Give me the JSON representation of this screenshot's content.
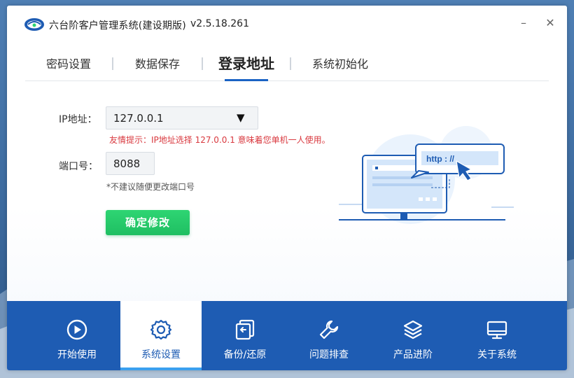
{
  "window": {
    "title": "六台阶客户管理系统(建设期版)",
    "version": "v2.5.18.261",
    "minimize_glyph": "–",
    "close_glyph": "✕"
  },
  "tabs": [
    {
      "label": "密码设置",
      "active": false
    },
    {
      "label": "数据保存",
      "active": false
    },
    {
      "label": "登录地址",
      "active": true
    },
    {
      "label": "系统初始化",
      "active": false
    }
  ],
  "form": {
    "ip_label": "IP地址：",
    "ip_value": "127.0.0.1",
    "ip_dropdown_glyph": "▼",
    "hint": "友情提示：IP地址选择 127.0.0.1 意味着您单机一人使用。",
    "port_label": "端口号：",
    "port_value": "8088",
    "port_note": "*不建议随便更改端口号",
    "confirm_label": "确定修改"
  },
  "illustration": {
    "url_text": "http : //"
  },
  "bottom_nav": [
    {
      "label": "开始使用",
      "icon": "play-circle-icon",
      "active": false
    },
    {
      "label": "系统设置",
      "icon": "gear-icon",
      "active": true
    },
    {
      "label": "备份/还原",
      "icon": "backup-restore-icon",
      "active": false
    },
    {
      "label": "问题排查",
      "icon": "wrench-icon",
      "active": false
    },
    {
      "label": "产品进阶",
      "icon": "layers-icon",
      "active": false
    },
    {
      "label": "关于系统",
      "icon": "monitor-icon",
      "active": false
    }
  ],
  "colors": {
    "accent": "#1e5cb3",
    "confirm": "#1fbf62",
    "hint": "#d9393f"
  }
}
